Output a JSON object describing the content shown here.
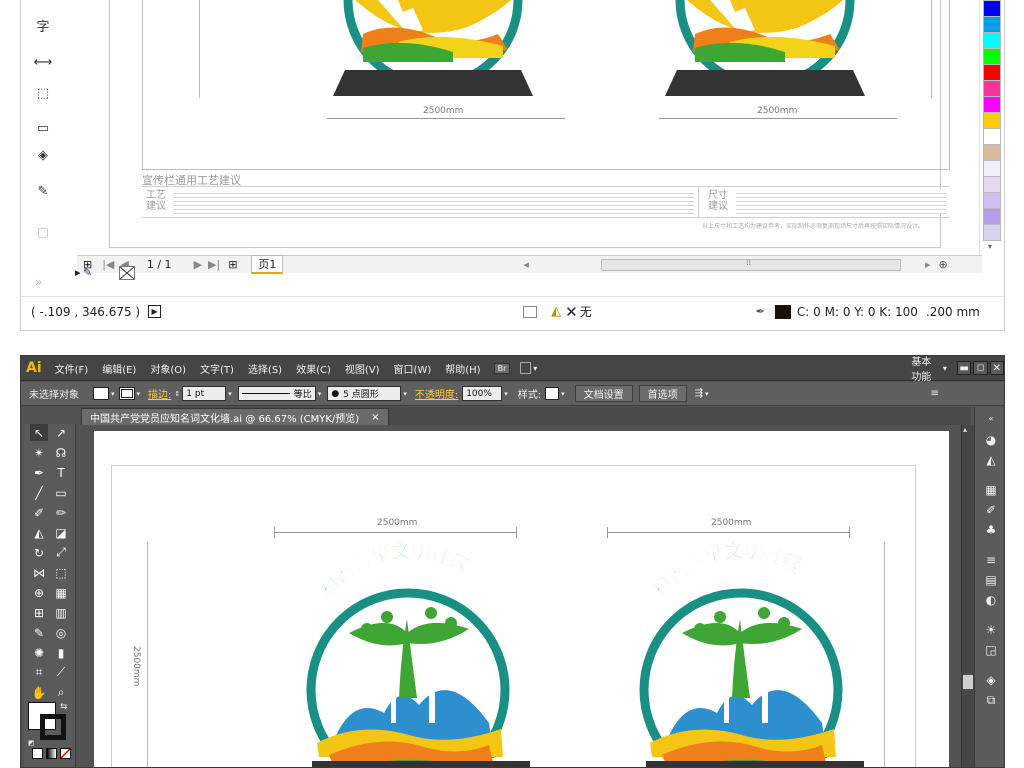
{
  "top_window": {
    "tools": [
      "字",
      "⟷",
      "⬚",
      "▭",
      "◈",
      "✎",
      "▢"
    ],
    "design": {
      "dimension_left": "2500mm",
      "dimension_right": "2500mm",
      "note_title": "宣传栏通用工艺建议",
      "note_label_left": "工艺\n建议",
      "note_label_right": "尺寸\n建议",
      "note_footer": "以上尺寸和工艺均为建议参考，实际制作必须复测现场尺寸后再按照实际情况设计。"
    },
    "palette": [
      "#0000ff",
      "#00a0e9",
      "#00ffff",
      "#00ff00",
      "#ff0000",
      "#ff3399",
      "#ff00ff",
      "#ffcc00",
      "#ffffff",
      "#d9b89c",
      "#f2f0f7",
      "#e3d7f2",
      "#cfc0ef",
      "#b59ee6",
      "#d9d2ee"
    ],
    "page_bar": {
      "page_counter": "1 / 1",
      "page_tab": "页1"
    },
    "status": {
      "coordinates": "( -.109 , 346.675 )",
      "fill_label": "无",
      "color_readout": "C: 0 M: 0 Y: 0 K: 100",
      "stroke_width": ".200 mm"
    }
  },
  "ai_window": {
    "logo": "Ai",
    "menus": [
      "文件(F)",
      "编辑(E)",
      "对象(O)",
      "文字(T)",
      "选择(S)",
      "效果(C)",
      "视图(V)",
      "窗口(W)",
      "帮助(H)"
    ],
    "br_badge": "Br",
    "workspace": "基本功能",
    "control": {
      "selection_state": "未选择对象",
      "stroke_label": "描边:",
      "stroke_value": "1 pt",
      "stroke_style": "等比",
      "brush": "5 点圆形",
      "opacity_label": "不透明度:",
      "opacity_value": "100%",
      "style_label": "样式:",
      "doc_setup": "文档设置",
      "preferences": "首选项"
    },
    "doc_tab": "中国共产党党员应知名词文化墙.ai @ 66.67% (CMYK/预览)",
    "doc_tab_close": "×",
    "artwork": {
      "title_text": "和谐邻里文明社区",
      "dimension_left": "2500mm",
      "dimension_right": "2500mm",
      "height_dim": "2500mm"
    }
  }
}
